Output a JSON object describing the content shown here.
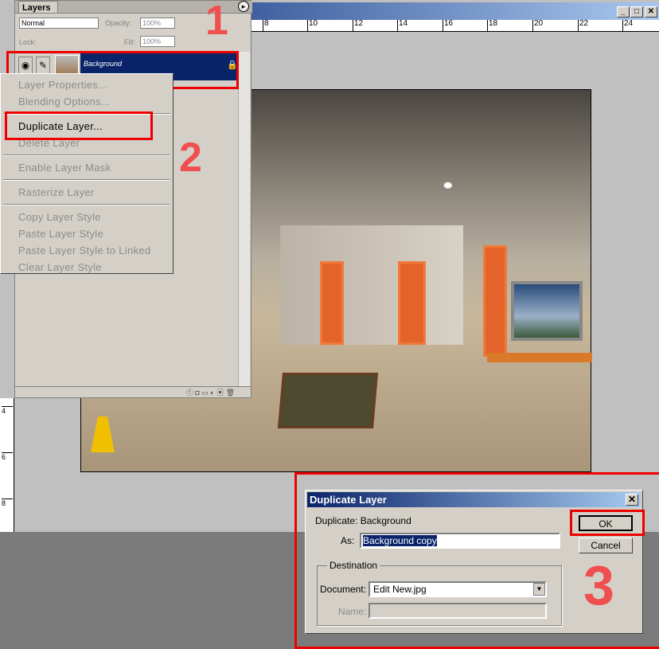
{
  "document": {
    "ruler_ticks": [
      "8",
      "10",
      "12",
      "14",
      "16",
      "18",
      "20",
      "22",
      "24"
    ],
    "vruler_ticks": [
      "4",
      "6",
      "8"
    ],
    "window_buttons": {
      "minimize": "_",
      "maximize": "□",
      "close": "✕"
    }
  },
  "layers_panel": {
    "tab": "Layers",
    "blend_mode": "Normal",
    "opacity_label": "Opacity:",
    "opacity": "100%",
    "lock_label": "Lock:",
    "fill_label": "Fill:",
    "fill": "100%",
    "layer_name": "Background",
    "menu_button": "▸"
  },
  "context_menu": {
    "items": [
      {
        "label": "Layer Properties...",
        "enabled": false
      },
      {
        "label": "Blending Options...",
        "enabled": false
      },
      {
        "label": "Duplicate Layer...",
        "enabled": true
      },
      {
        "label": "Delete Layer",
        "enabled": false
      },
      {
        "label": "Enable Layer Mask",
        "enabled": false
      },
      {
        "label": "Rasterize Layer",
        "enabled": false
      },
      {
        "label": "Copy Layer Style",
        "enabled": false
      },
      {
        "label": "Paste Layer Style",
        "enabled": false
      },
      {
        "label": "Paste Layer Style to Linked",
        "enabled": false
      },
      {
        "label": "Clear Layer Style",
        "enabled": false
      }
    ]
  },
  "annotations": {
    "step1": "1",
    "step2": "2",
    "step3": "3",
    "color": "#ef4f4f"
  },
  "dialog": {
    "title": "Duplicate Layer",
    "close": "✕",
    "duplicate_label": "Duplicate: Background",
    "as_label": "As:",
    "as_value": "Background copy",
    "destination_label": "Destination",
    "document_label": "Document:",
    "document_value": "Edit New.jpg",
    "name_label": "Name:",
    "ok": "OK",
    "cancel": "Cancel"
  }
}
